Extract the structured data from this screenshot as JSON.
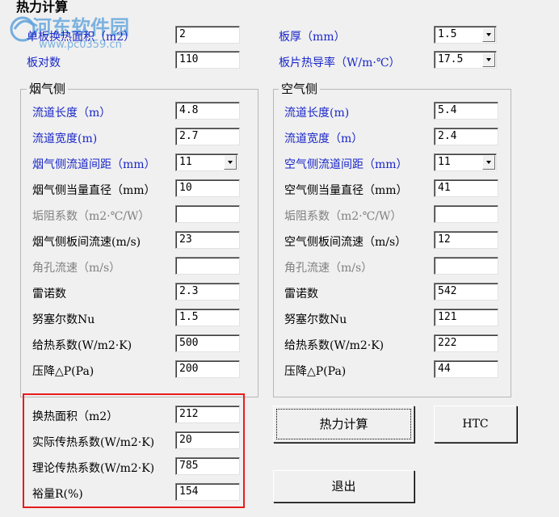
{
  "window": {
    "title": "热力计算",
    "watermark_text": "河东软件园",
    "watermark_url": "www.pc0359.cn"
  },
  "top": {
    "single_area": {
      "label": "单板换热面积（m2）",
      "value": "2"
    },
    "plate_count": {
      "label": "板对数",
      "value": "110"
    },
    "plate_thickness": {
      "label": "板厚（mm）",
      "value": "1.5"
    },
    "plate_conductivity": {
      "label": "板片热导率（W/m·℃）",
      "value": "17.5"
    }
  },
  "flue": {
    "title": "烟气侧",
    "rows": [
      {
        "label": "流道长度（m）",
        "value": "4.8",
        "style": "blue"
      },
      {
        "label": "流道宽度(m)",
        "value": "2.7",
        "style": "blue"
      },
      {
        "label": "烟气侧流道间距（mm）",
        "value": "11",
        "style": "blue",
        "select": true
      },
      {
        "label": "烟气侧当量直径（mm）",
        "value": "10",
        "style": "black"
      },
      {
        "label": "垢阻系数（m2·℃/W）",
        "value": "",
        "style": "gray"
      },
      {
        "label": "烟气侧板间流速(m/s)",
        "value": "23",
        "style": "black"
      },
      {
        "label": "角孔流速（m/s）",
        "value": "",
        "style": "gray"
      },
      {
        "label": "雷诺数",
        "value": "2.3",
        "style": "black"
      },
      {
        "label": "努塞尔数Nu",
        "value": "1.5",
        "style": "black"
      },
      {
        "label": "给热系数(W/m2·K)",
        "value": "500",
        "style": "black"
      },
      {
        "label": "压降△P(Pa)",
        "value": "200",
        "style": "black"
      }
    ]
  },
  "air": {
    "title": "空气侧",
    "rows": [
      {
        "label": "流道长度(m)",
        "value": "5.4",
        "style": "blue"
      },
      {
        "label": "流道宽度（m）",
        "value": "2.4",
        "style": "blue"
      },
      {
        "label": "空气侧流道间距（mm）",
        "value": "11",
        "style": "blue",
        "select": true
      },
      {
        "label": "空气侧当量直径（mm）",
        "value": "41",
        "style": "black"
      },
      {
        "label": "垢阻系数（m2·℃/W）",
        "value": "",
        "style": "gray"
      },
      {
        "label": "空气侧板间流速（m/s）",
        "value": "12",
        "style": "black"
      },
      {
        "label": "角孔流速（m/s）",
        "value": "",
        "style": "gray"
      },
      {
        "label": "雷诺数",
        "value": "542",
        "style": "black"
      },
      {
        "label": "努塞尔数Nu",
        "value": "121",
        "style": "black"
      },
      {
        "label": "给热系数(W/m2·K)",
        "value": "222",
        "style": "black"
      },
      {
        "label": "压降△P(Pa)",
        "value": "44",
        "style": "black"
      }
    ]
  },
  "results": {
    "rows": [
      {
        "label": "换热面积（m2）",
        "value": "212"
      },
      {
        "label": "实际传热系数(W/m2·K)",
        "value": "20"
      },
      {
        "label": "理论传热系数(W/m2·K)",
        "value": "785"
      },
      {
        "label": "裕量R(%)",
        "value": "154"
      }
    ]
  },
  "buttons": {
    "calc": "热力计算",
    "htc": "HTC",
    "exit": "退出"
  },
  "colors": {
    "highlight_box": "#e81c1c",
    "blue_label": "#1a27c8",
    "gray_label": "#808080"
  }
}
